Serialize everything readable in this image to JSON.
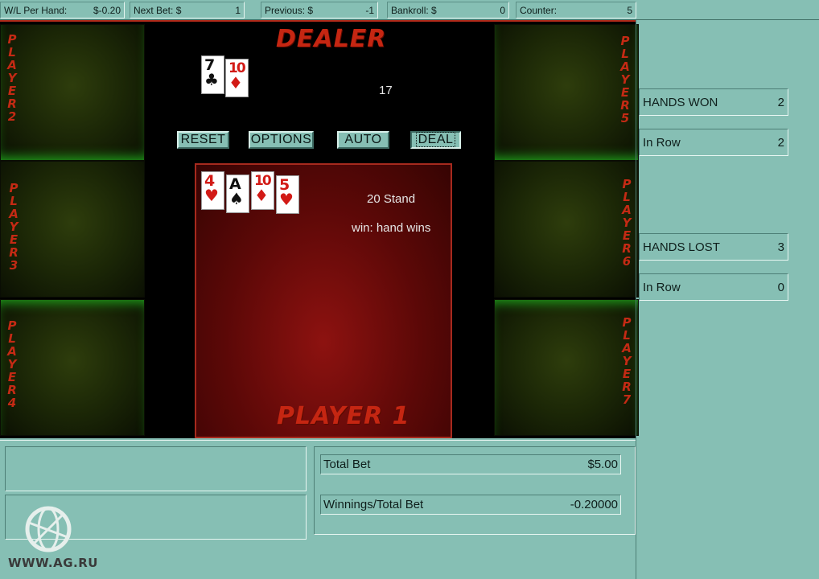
{
  "status_bar": [
    {
      "label": "W/L Per Hand:",
      "value": "$-0.20"
    },
    {
      "label": "Next Bet: $",
      "value": "1"
    },
    {
      "label": "Previous: $",
      "value": "-1"
    },
    {
      "label": "Bankroll: $",
      "value": "0"
    },
    {
      "label": "Counter:",
      "value": "5"
    }
  ],
  "seats": {
    "p2": "PLAYER 2",
    "p3": "PLAYER 3",
    "p4": "PLAYER 4",
    "p5": "PLAYER 5",
    "p6": "PLAYER 6",
    "p7": "PLAYER 7"
  },
  "dealer": {
    "title": "DEALER",
    "total": "17",
    "cards": [
      {
        "rank": "7",
        "suit": "♣",
        "color": "#111111"
      },
      {
        "rank": "10",
        "suit": "♦",
        "color": "#d21a16"
      }
    ]
  },
  "buttons": {
    "reset": "RESET",
    "options": "OPTIONS",
    "auto": "AUTO",
    "deal": "DEAL"
  },
  "player1": {
    "title": "PLAYER 1",
    "status": "20  Stand",
    "result": "win: hand wins",
    "cards": [
      {
        "rank": "4",
        "suit": "♥",
        "color": "#d21a16"
      },
      {
        "rank": "A",
        "suit": "♠",
        "color": "#111111"
      },
      {
        "rank": "10",
        "suit": "♦",
        "color": "#d21a16"
      },
      {
        "rank": "5",
        "suit": "♥",
        "color": "#d21a16"
      }
    ]
  },
  "right_panel": {
    "hands_won_label": "HANDS WON",
    "hands_won_value": "2",
    "won_in_row_label": "In Row",
    "won_in_row_value": "2",
    "hands_lost_label": "HANDS LOST",
    "hands_lost_value": "3",
    "lost_in_row_label": "In Row",
    "lost_in_row_value": "0"
  },
  "bottom": {
    "total_bet_label": "Total Bet",
    "total_bet_value": "$5.00",
    "winnings_ratio_label": "Winnings/Total Bet",
    "winnings_ratio_value": "-0.20000"
  },
  "watermark": "WWW.AG.RU",
  "colors": {
    "panel": "#86bfb4",
    "felt_red": "#8d1210",
    "title_red": "#c52612",
    "seat_glow": "#1f9a1a"
  }
}
